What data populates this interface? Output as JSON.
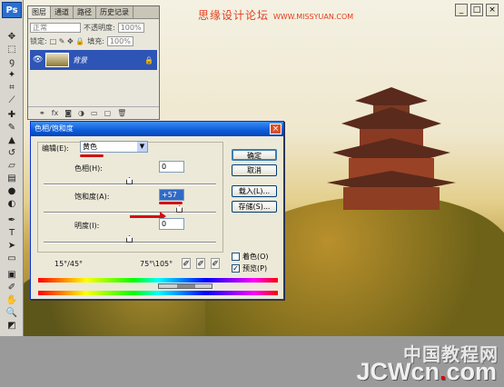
{
  "toolbar": {
    "logo": "Ps"
  },
  "photo_watermark": {
    "text": "思缘设计论坛",
    "url": "WWW.MISSYUAN.COM"
  },
  "layers_panel": {
    "tabs": [
      "图层",
      "通道",
      "路径",
      "历史记录"
    ],
    "blend_mode": "正常",
    "opacity_label": "不透明度:",
    "opacity_value": "100%",
    "lock_label": "锁定:",
    "fill_label": "填充:",
    "fill_value": "100%",
    "layer_name": "背景"
  },
  "dialog": {
    "title": "色相/饱和度",
    "close": "×",
    "edit_label": "编辑(E):",
    "edit_value": "黄色",
    "hue_label": "色相(H):",
    "hue_value": "0",
    "saturation_label": "饱和度(A):",
    "saturation_value": "+57",
    "lightness_label": "明度(I):",
    "lightness_value": "0",
    "range_left": "15°/45°",
    "range_right": "75°\\105°",
    "buttons": {
      "ok": "确定",
      "cancel": "取消",
      "load": "载入(L)...",
      "save": "存储(S)..."
    },
    "colorize_label": "着色(O)",
    "preview_label": "预览(P)",
    "hue_level": 0.5,
    "saturation_level": 0.79,
    "lightness_level": 0.5
  },
  "bottom_watermark": {
    "chinese": "中国教程网",
    "brand_prefix": "JCWcn",
    "brand_dot": ".",
    "brand_suffix": "com"
  }
}
